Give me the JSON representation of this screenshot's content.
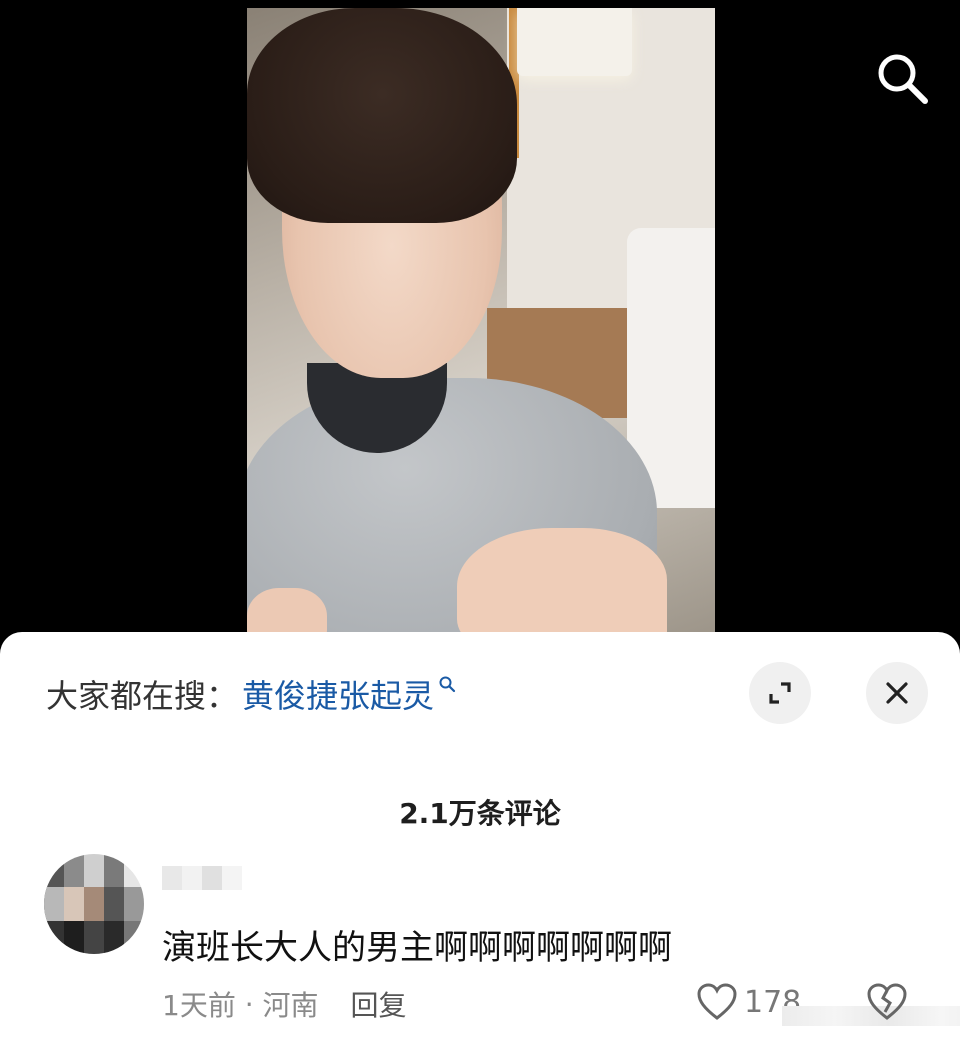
{
  "search_bar": {
    "prefix": "大家都在搜：",
    "term": "黄俊捷张起灵"
  },
  "comments": {
    "count_label": "2.1万条评论",
    "items": [
      {
        "text": "演班长大人的男主啊啊啊啊啊啊啊",
        "time": "1天前",
        "separator": " · ",
        "location": "河南",
        "reply_label": "回复",
        "likes": "178"
      }
    ]
  },
  "icons": {
    "top_right": "search-icon",
    "expand": "expand-icon",
    "close": "close-icon",
    "like": "heart-icon",
    "dislike": "broken-heart-icon"
  },
  "colors": {
    "search_term": "#1a5aa5",
    "sheet_bg": "#ffffff",
    "background": "#000000"
  }
}
